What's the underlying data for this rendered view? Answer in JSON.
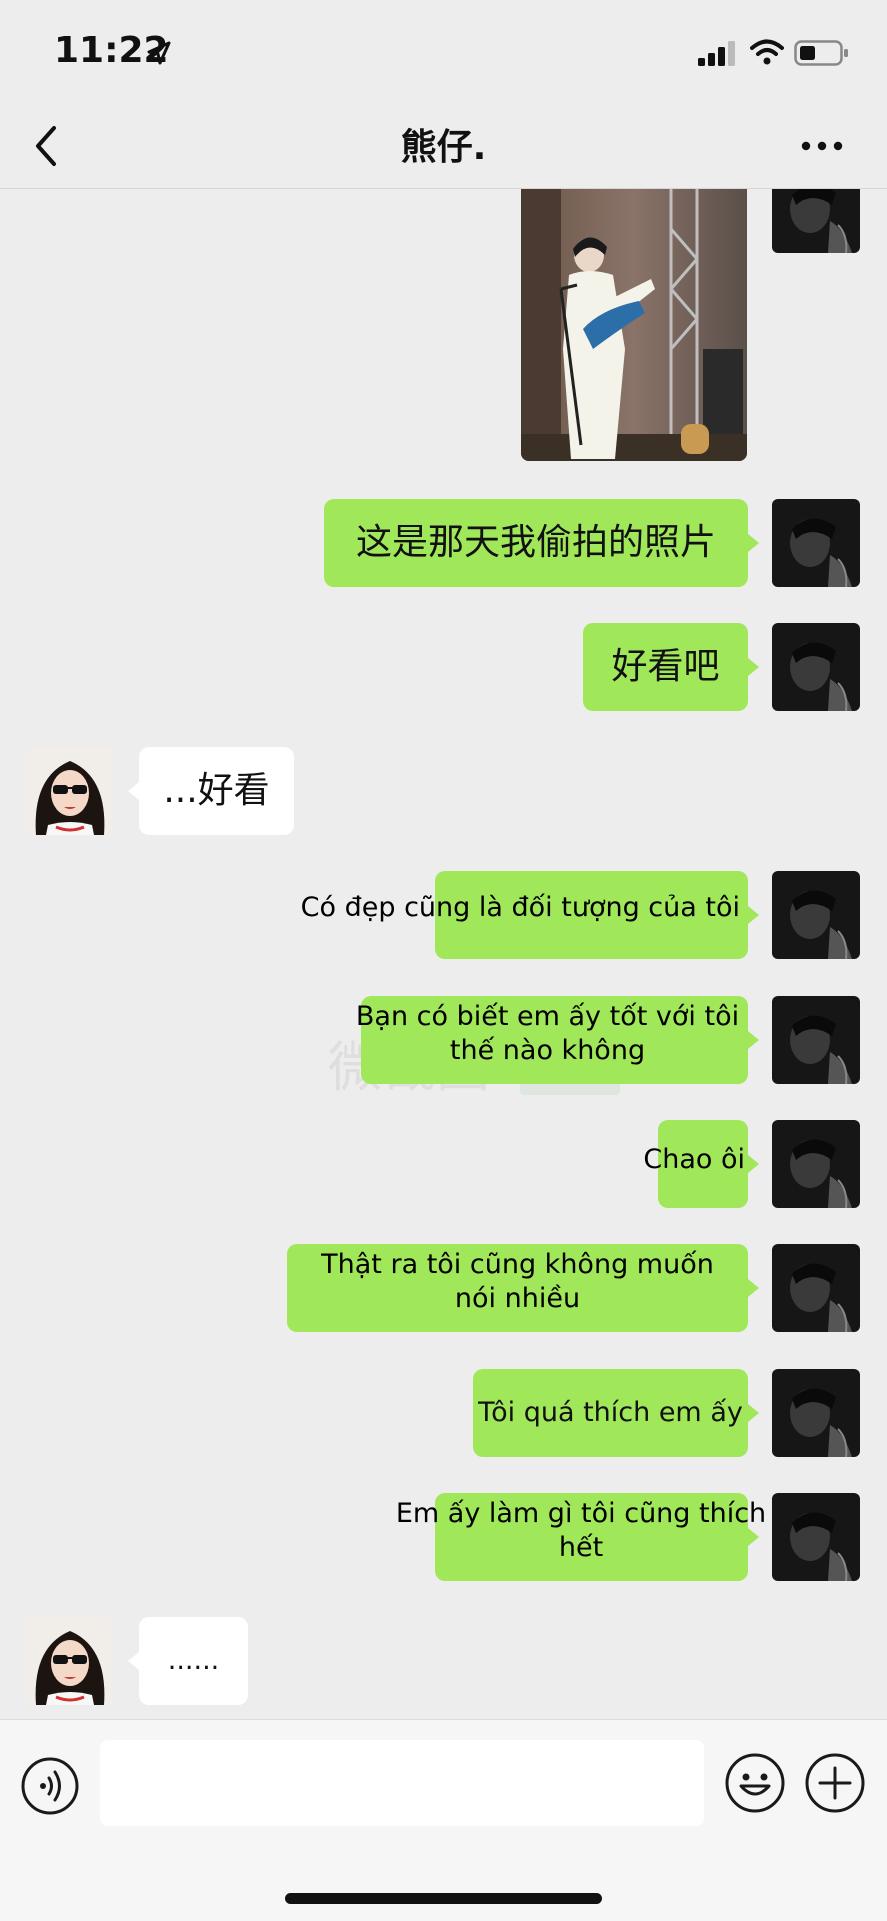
{
  "status_bar": {
    "time": "11:22"
  },
  "header": {
    "title": "熊仔."
  },
  "watermark": {
    "text": "微截图"
  },
  "messages": [
    {
      "side": "out",
      "type": "image"
    },
    {
      "side": "out",
      "text": "这是那天我偷拍的照片"
    },
    {
      "side": "out",
      "text": "好看吧"
    },
    {
      "side": "in",
      "text": "...好看"
    },
    {
      "side": "out",
      "text": "Có đẹp cũng là đối tượng của tôi"
    },
    {
      "side": "out",
      "line1": "Bạn có biết em ấy tốt với tôi",
      "line2": "thế nào không"
    },
    {
      "side": "out",
      "text": "Chao ôi"
    },
    {
      "side": "out",
      "line1": "Thật ra tôi cũng không muốn",
      "line2": "nói nhiều"
    },
    {
      "side": "out",
      "text": "Tôi quá thích em ấy"
    },
    {
      "side": "out",
      "line1": "Em ấy làm gì tôi cũng thích",
      "line2": "hết"
    },
    {
      "side": "in",
      "text": "......"
    }
  ],
  "colors": {
    "outgoing_bubble": "#a0e75a",
    "incoming_bubble": "#ffffff",
    "background": "#ededed"
  },
  "icons": [
    "back-arrow",
    "more-dots",
    "voice",
    "emoji",
    "plus"
  ]
}
